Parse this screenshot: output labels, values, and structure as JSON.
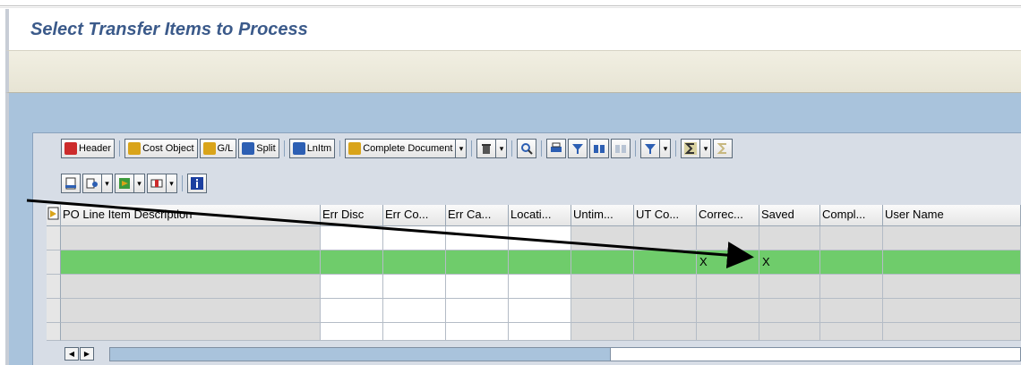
{
  "page": {
    "title": "Select Transfer Items to Process"
  },
  "toolbar": {
    "header_label": "Header",
    "cost_object_label": "Cost Object",
    "gl_label": "G/L",
    "split_label": "Split",
    "lnitm_label": "LnItm",
    "complete_document_label": "Complete Document"
  },
  "grid": {
    "columns": [
      "PO Line Item Description",
      "Err Disc",
      "Err Co...",
      "Err Ca...",
      "Locati...",
      "Untim...",
      "UT Co...",
      "Correc...",
      "Saved",
      "Compl...",
      "User Name"
    ],
    "selected_row": {
      "correction": "X",
      "saved": "X"
    }
  },
  "colors": {
    "title": "#3b5a8a",
    "selected_row": "#6fcc6b",
    "background_blue": "#a9c3dc"
  },
  "icons": {
    "header": "header-icon",
    "cost_object": "cost-object-icon",
    "gl": "gl-icon",
    "split": "split-icon",
    "lnitm": "lnitm-icon",
    "complete_document": "complete-document-icon",
    "delete": "trash-icon",
    "details": "details-icon",
    "print": "print-icon",
    "filter": "filter-icon",
    "find": "find-icon",
    "sum": "sum-icon",
    "info": "info-icon"
  }
}
